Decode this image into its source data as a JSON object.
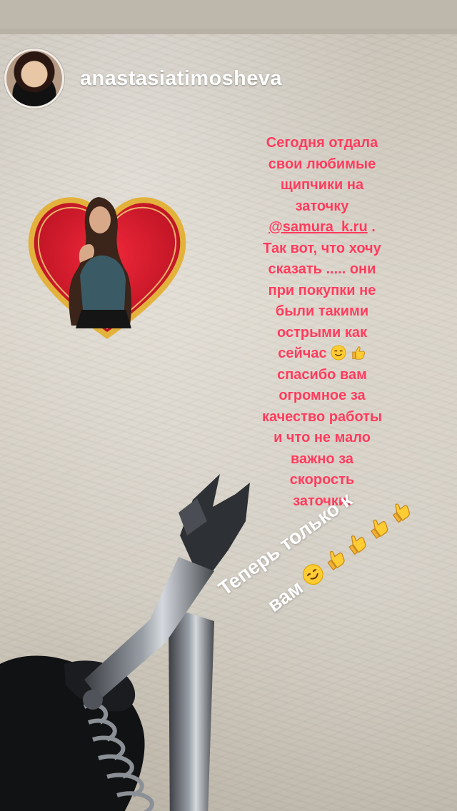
{
  "story": {
    "username": "anastasiatimosheva",
    "caption": {
      "l1": "Сегодня отдала",
      "l2": "свои любимые",
      "l3": "щипчики на",
      "l4": "заточку",
      "mention": "@samura_k.ru",
      "mention_suffix": " .",
      "l6": "Так вот, что хочу",
      "l7": "сказать ..... они",
      "l8": "при покупки не",
      "l9": "были такими",
      "l10": "острыми как",
      "l11": "сейчас",
      "l12": "спасибо вам",
      "l13": "огромное за",
      "l14": "качество работы",
      "l15": "и что не мало",
      "l16": "важно за",
      "l17": "скорость",
      "l18": "заточки."
    },
    "sticker": {
      "line1": "Теперь только к",
      "line2": "вам"
    }
  },
  "icons": {
    "smile": "smiling-face-icon",
    "thumb": "thumbs-up-icon"
  },
  "colors": {
    "caption": "#ff3b5c",
    "username": "#ffffff",
    "heart": "#d6162a",
    "heart_border": "#e3b23c"
  }
}
